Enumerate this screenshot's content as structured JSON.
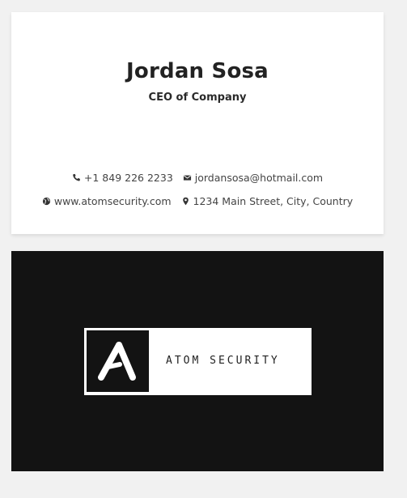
{
  "front": {
    "name": "Jordan Sosa",
    "title": "CEO of Company",
    "phone": "+1 849 226 2233",
    "email": "jordansosa@hotmail.com",
    "website": "www.atomsecurity.com",
    "address": "1234 Main Street, City, Country",
    "icons": {
      "phone": "phone-icon",
      "email": "envelope-icon",
      "website": "globe-icon",
      "address": "map-pin-icon"
    }
  },
  "back": {
    "brand": "ATOM SECURITY",
    "logo_icon": "atom-a-logo-icon",
    "colors": {
      "background": "#131313",
      "logo_box": "#ffffff"
    }
  }
}
